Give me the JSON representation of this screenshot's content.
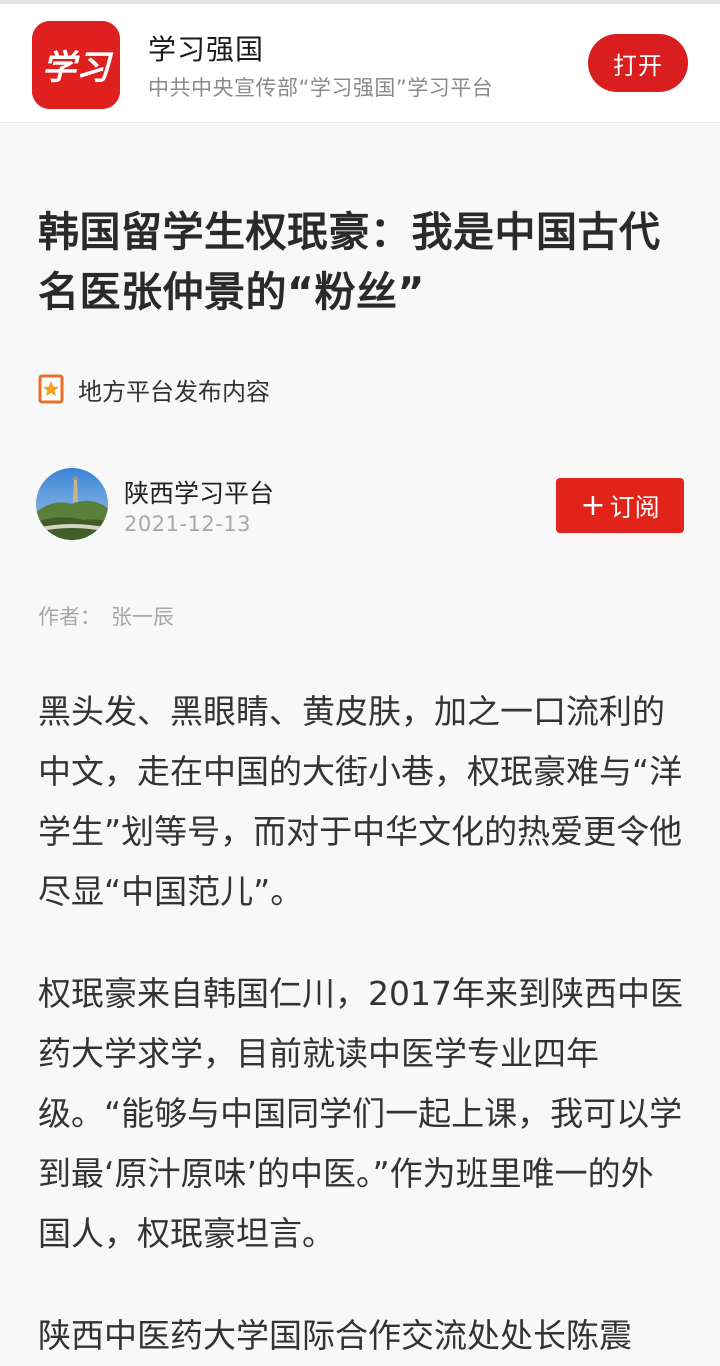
{
  "banner": {
    "app_name": "学习强国",
    "app_desc": "中共中央宣传部“学习强国”学习平台",
    "logo_text": "学习",
    "open_label": "打开"
  },
  "article": {
    "title": "韩国留学生权珉豪：我是中国古代名医张仲景的“粉丝”",
    "local_label": "地方平台发布内容",
    "author": "陕西学习平台",
    "date": "2021-12-13",
    "subscribe_plus": "+",
    "subscribe_label": "订阅",
    "byline_label": "作者：",
    "byline_name": "张一辰",
    "paragraphs": [
      "黑头发、黑眼睛、黄皮肤，加之一口流利的中文，走在中国的大街小巷，权珉豪难与“洋学生”划等号，而对于中华文化的热爱更令他尽显“中国范儿”。",
      "权珉豪来自韩国仁川，2017年来到陕西中医药大学求学，目前就读中医学专业四年级。“能够与中国同学们一起上课，我可以学到最‘原汁原味’的中医。”作为班里唯一的外国人，权珉豪坦言。",
      "陕西中医药大学国际合作交流处处长陈震"
    ]
  },
  "colors": {
    "brand_red": "#d81e1e",
    "subscribe_red": "#e2231a",
    "background": "#f8f8f8"
  },
  "icons": {
    "local_badge": "star-bookmark-icon",
    "logo": "xuexi-logo"
  }
}
